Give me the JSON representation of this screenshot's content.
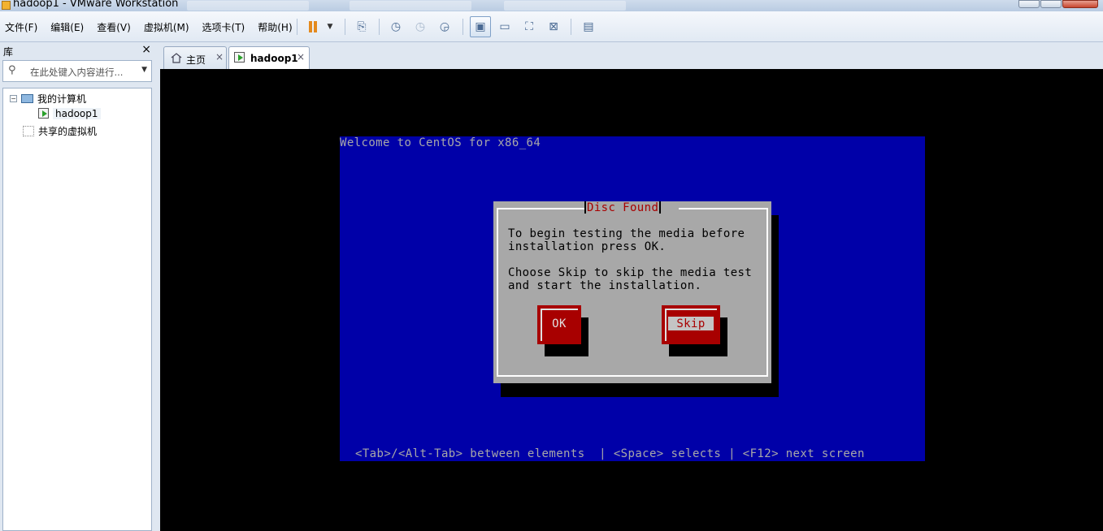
{
  "window": {
    "title": "hadoop1 - VMware Workstation"
  },
  "menu": {
    "items": [
      "文件(F)",
      "编辑(E)",
      "查看(V)",
      "虚拟机(M)",
      "选项卡(T)",
      "帮助(H)"
    ]
  },
  "toolbar": {
    "icons": [
      "pause-icon",
      "dropdown-icon",
      "send-keys-icon",
      "snapshot-icon",
      "revert-snapshot-icon",
      "snapshot-manager-icon",
      "library-view-icon",
      "thumbnail-view-icon",
      "fullscreen-icon",
      "unity-icon",
      "console-view-icon"
    ]
  },
  "library": {
    "title": "库",
    "close": "×",
    "search_placeholder": "在此处键入内容进行...",
    "tree": {
      "root_label": "我的计算机",
      "vm_label": "hadoop1",
      "shared_label": "共享的虚拟机",
      "expander": "−"
    }
  },
  "tabs": [
    {
      "label": "主页",
      "close": "×"
    },
    {
      "label": "hadoop1",
      "close": "×"
    }
  ],
  "console": {
    "welcome": "Welcome to CentOS for x86_64",
    "dialog_title": "Disc Found",
    "message": "To begin testing the media before\ninstallation press OK.\n\nChoose Skip to skip the media test\nand start the installation.",
    "ok_label": "OK",
    "skip_label": "Skip",
    "footer": "<Tab>/<Alt-Tab> between elements  | <Space> selects | <F12> next screen"
  },
  "colors": {
    "screen_bg": "#0000a8",
    "dialog_bg": "#a8a8a8",
    "title_red": "#a80000",
    "button_red": "#a80000"
  }
}
